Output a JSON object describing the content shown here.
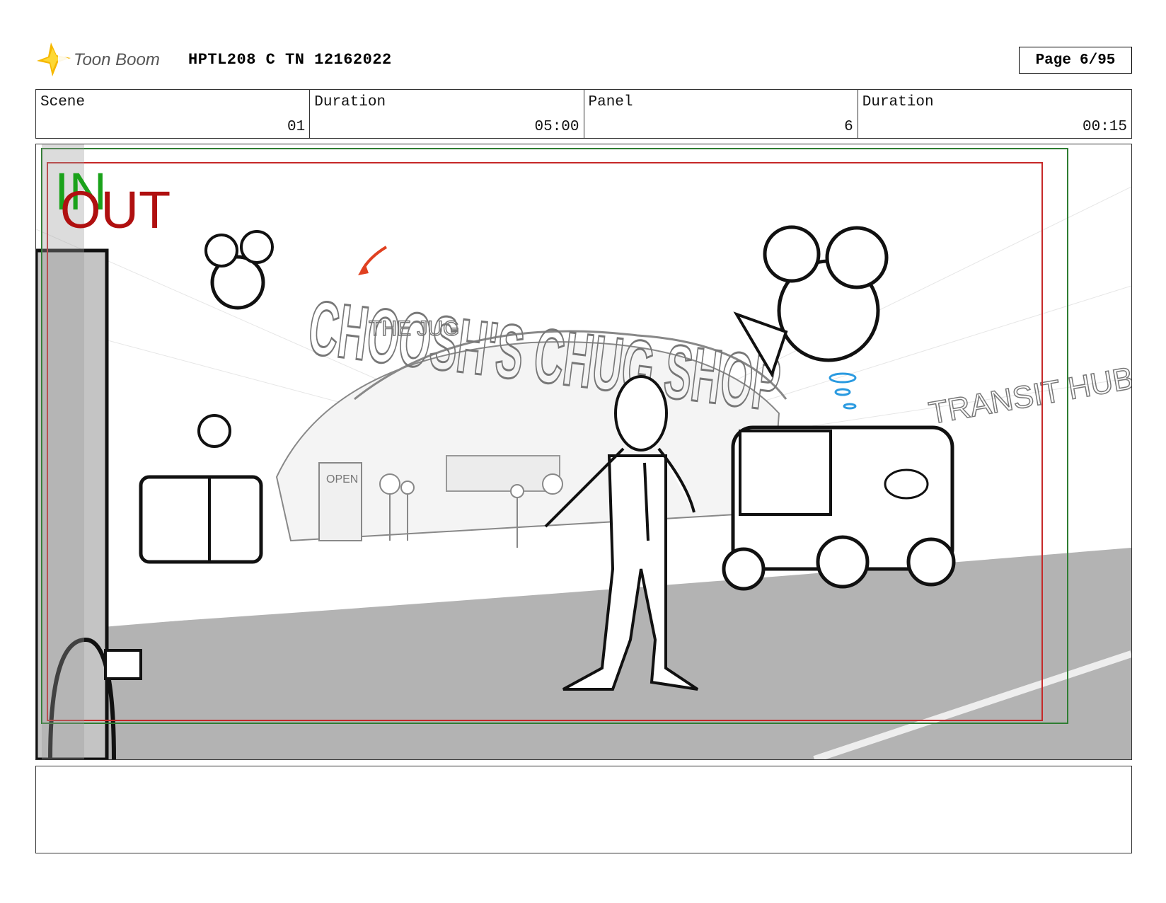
{
  "header": {
    "logo_text": "Toon Boom",
    "title": "HPTL208 C TN 12162022",
    "page_label": "Page",
    "page_value": "6/95"
  },
  "info": [
    {
      "label": "Scene",
      "value": "01"
    },
    {
      "label": "Duration",
      "value": "05:00"
    },
    {
      "label": "Panel",
      "value": "6"
    },
    {
      "label": "Duration",
      "value": "00:15"
    }
  ],
  "panel": {
    "in_label": "IN",
    "out_label": "OUT",
    "sign_main": "CHOOSH'S CHUG SHOP",
    "sign_back": "THE JUG",
    "sign_transit": "TRANSIT HUB",
    "sign_open": "OPEN",
    "colors": {
      "in_marker": "#1aa21a",
      "out_marker": "#b01010",
      "safe_frame_green": "#2e7d32",
      "safe_frame_red": "#c62828",
      "accent_blue": "#2a9ae0",
      "accent_red": "#e04020"
    }
  },
  "notes": {
    "text": ""
  }
}
